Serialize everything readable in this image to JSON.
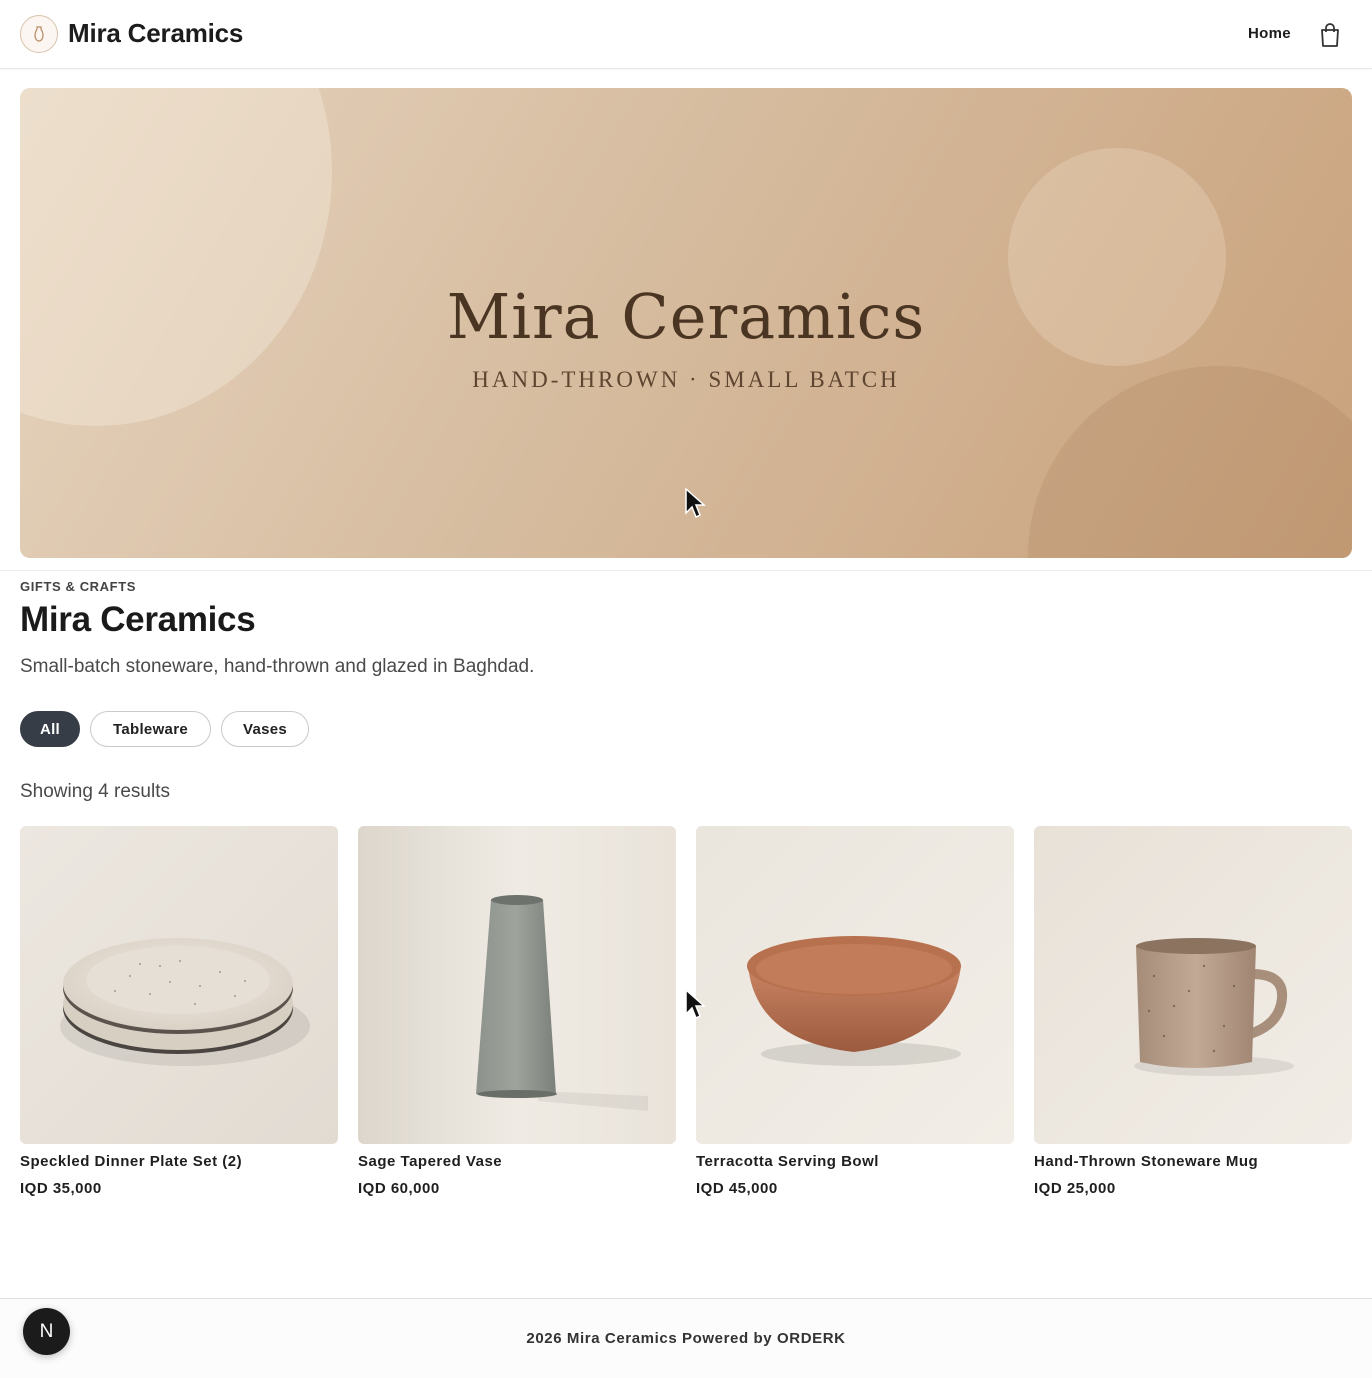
{
  "header": {
    "brand": "Mira Ceramics",
    "nav_home": "Home",
    "logo_icon": "vase-logo-icon",
    "cart_icon": "shopping-bag-icon"
  },
  "hero": {
    "title": "Mira Ceramics",
    "subtitle": "HAND-THROWN · SMALL BATCH"
  },
  "store": {
    "category": "GIFTS & CRAFTS",
    "title": "Mira Ceramics",
    "description": "Small-batch stoneware, hand-thrown and glazed in Baghdad."
  },
  "filters": [
    {
      "label": "All",
      "active": true
    },
    {
      "label": "Tableware",
      "active": false
    },
    {
      "label": "Vases",
      "active": false
    }
  ],
  "results_text": "Showing 4 results",
  "products": [
    {
      "name": "Speckled Dinner Plate Set (2)",
      "price": "IQD 35,000"
    },
    {
      "name": "Sage Tapered Vase",
      "price": "IQD 60,000"
    },
    {
      "name": "Terracotta Serving Bowl",
      "price": "IQD 45,000"
    },
    {
      "name": "Hand-Thrown Stoneware Mug",
      "price": "IQD 25,000"
    }
  ],
  "footer": {
    "text": "2026 Mira Ceramics Powered by ORDERK",
    "badge": "N"
  },
  "colors": {
    "accent_dark": "#373d47",
    "hero_tan": "#d6bc9f",
    "hero_text": "#4a3422"
  }
}
